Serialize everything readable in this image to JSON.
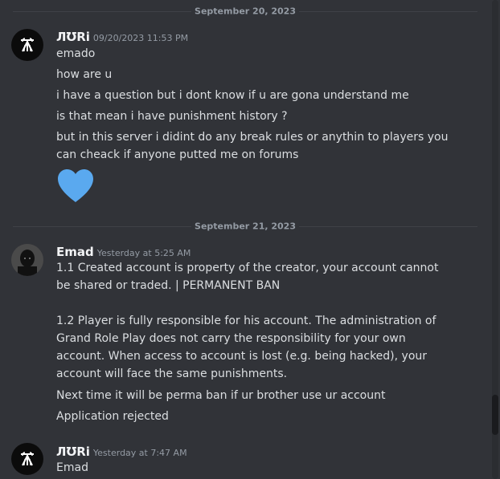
{
  "dividers": {
    "first_date": "September 20, 2023",
    "second_date": "September 21, 2023"
  },
  "messages": {
    "group1": {
      "author": "ЛƱRi",
      "timestamp": "09/20/2023 11:53 PM",
      "lines": [
        "emado",
        "how are u",
        "i have a question but i dont know if u are gona understand me",
        "is that mean i have punishment history ?",
        "but in this server i didint do any break rules or anythin to players you can cheack if anyone putted me on forums"
      ],
      "emoji": "blue-heart"
    },
    "group2": {
      "author": "Emad",
      "timestamp": "Yesterday at 5:25 AM",
      "lines": [
        "1.1 Created account is property of the creator, your account cannot be shared or traded. | PERMANENT BAN",
        "1.2 Player is fully responsible for his account. The administration of Grand Role Play does not carry the responsibility for your own account. When access to account is lost (e.g. being hacked), your account will face the same punishments.",
        "Next time it will be perma ban if ur brother use ur account",
        "Application rejected"
      ]
    },
    "group3": {
      "author": "ЛƱRi",
      "timestamp": "Yesterday at 7:47 AM",
      "lines": [
        "Emad"
      ]
    }
  },
  "colors": {
    "background": "#313338",
    "text": "#dbdee1",
    "muted": "#949ba4",
    "heart": "#5aa9ef"
  }
}
